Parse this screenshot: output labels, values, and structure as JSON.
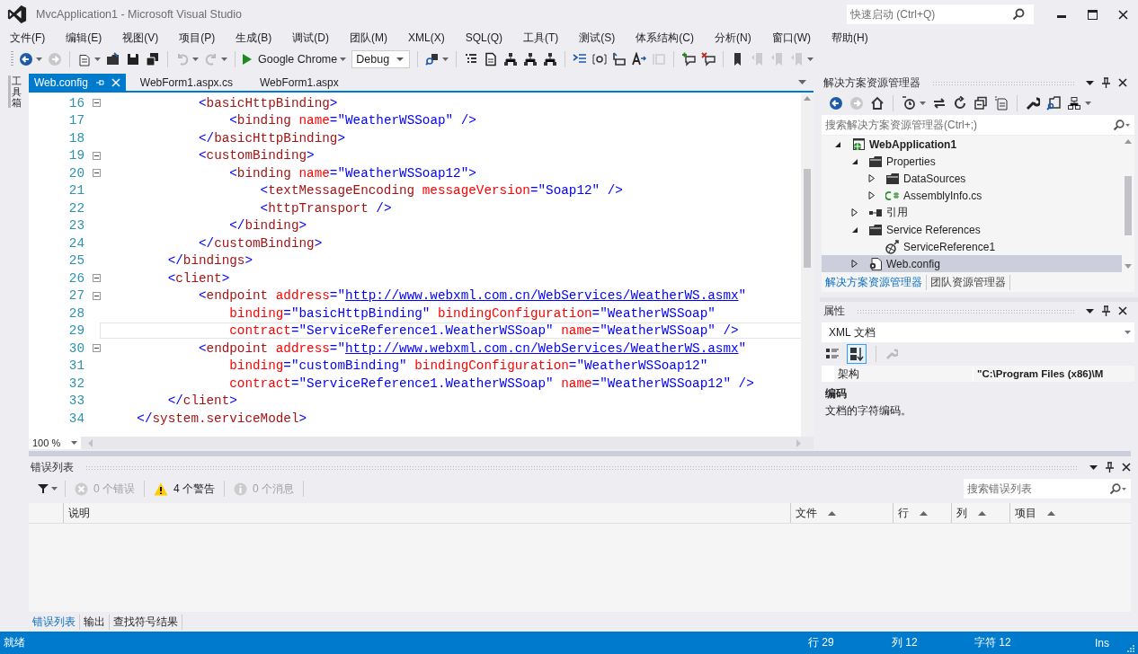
{
  "window": {
    "title": "MvcApplication1 - Microsoft Visual Studio",
    "quick_launch": {
      "placeholder": "快速启动 (Ctrl+Q)"
    }
  },
  "menu": [
    "文件(F)",
    "编辑(E)",
    "视图(V)",
    "项目(P)",
    "生成(B)",
    "调试(D)",
    "团队(M)",
    "XML(X)",
    "SQL(Q)",
    "工具(T)",
    "测试(S)",
    "体系结构(C)",
    "分析(N)",
    "窗口(W)",
    "帮助(H)"
  ],
  "toolbar": {
    "run_target": "Google Chrome",
    "configuration": "Debug"
  },
  "side_tab": "工具箱",
  "tabs": [
    {
      "label": "Web.config",
      "selected": true
    },
    {
      "label": "WebForm1.aspx.cs",
      "selected": false
    },
    {
      "label": "WebForm1.aspx",
      "selected": false
    }
  ],
  "editor": {
    "zoom": "100 %",
    "lines": [
      {
        "number": "16",
        "fold": true,
        "current": false,
        "tokens": [
          {
            "kind": "delim",
            "text": "            <"
          },
          {
            "kind": "tag",
            "text": "basicHttpBinding"
          },
          {
            "kind": "delim",
            "text": ">"
          }
        ]
      },
      {
        "number": "17",
        "fold": false,
        "current": false,
        "tokens": [
          {
            "kind": "delim",
            "text": "                <"
          },
          {
            "kind": "tag",
            "text": "binding"
          },
          {
            "kind": "attr",
            "text": " name"
          },
          {
            "kind": "delim",
            "text": "="
          },
          {
            "kind": "value",
            "text": "\"WeatherWSSoap\""
          },
          {
            "kind": "delim",
            "text": " />"
          }
        ]
      },
      {
        "number": "18",
        "fold": false,
        "current": false,
        "tokens": [
          {
            "kind": "delim",
            "text": "            </"
          },
          {
            "kind": "tag",
            "text": "basicHttpBinding"
          },
          {
            "kind": "delim",
            "text": ">"
          }
        ]
      },
      {
        "number": "19",
        "fold": true,
        "current": false,
        "tokens": [
          {
            "kind": "delim",
            "text": "            <"
          },
          {
            "kind": "tag",
            "text": "customBinding"
          },
          {
            "kind": "delim",
            "text": ">"
          }
        ]
      },
      {
        "number": "20",
        "fold": true,
        "current": false,
        "tokens": [
          {
            "kind": "delim",
            "text": "                <"
          },
          {
            "kind": "tag",
            "text": "binding"
          },
          {
            "kind": "attr",
            "text": " name"
          },
          {
            "kind": "delim",
            "text": "="
          },
          {
            "kind": "value",
            "text": "\"WeatherWSSoap12\""
          },
          {
            "kind": "delim",
            "text": ">"
          }
        ]
      },
      {
        "number": "21",
        "fold": false,
        "current": false,
        "tokens": [
          {
            "kind": "delim",
            "text": "                    <"
          },
          {
            "kind": "tag",
            "text": "textMessageEncoding"
          },
          {
            "kind": "attr",
            "text": " messageVersion"
          },
          {
            "kind": "delim",
            "text": "="
          },
          {
            "kind": "value",
            "text": "\"Soap12\""
          },
          {
            "kind": "delim",
            "text": " />"
          }
        ]
      },
      {
        "number": "22",
        "fold": false,
        "current": false,
        "tokens": [
          {
            "kind": "delim",
            "text": "                    <"
          },
          {
            "kind": "tag",
            "text": "httpTransport"
          },
          {
            "kind": "delim",
            "text": " />"
          }
        ]
      },
      {
        "number": "23",
        "fold": false,
        "current": false,
        "tokens": [
          {
            "kind": "delim",
            "text": "                </"
          },
          {
            "kind": "tag",
            "text": "binding"
          },
          {
            "kind": "delim",
            "text": ">"
          }
        ]
      },
      {
        "number": "24",
        "fold": false,
        "current": false,
        "tokens": [
          {
            "kind": "delim",
            "text": "            </"
          },
          {
            "kind": "tag",
            "text": "customBinding"
          },
          {
            "kind": "delim",
            "text": ">"
          }
        ]
      },
      {
        "number": "25",
        "fold": false,
        "current": false,
        "tokens": [
          {
            "kind": "delim",
            "text": "        </"
          },
          {
            "kind": "tag",
            "text": "bindings"
          },
          {
            "kind": "delim",
            "text": ">"
          }
        ]
      },
      {
        "number": "26",
        "fold": true,
        "current": false,
        "tokens": [
          {
            "kind": "delim",
            "text": "        <"
          },
          {
            "kind": "tag",
            "text": "client"
          },
          {
            "kind": "delim",
            "text": ">"
          }
        ]
      },
      {
        "number": "27",
        "fold": true,
        "current": false,
        "tokens": [
          {
            "kind": "delim",
            "text": "            <"
          },
          {
            "kind": "tag",
            "text": "endpoint"
          },
          {
            "kind": "attr",
            "text": " address"
          },
          {
            "kind": "delim",
            "text": "=\""
          },
          {
            "kind": "link",
            "text": "http://www.webxml.com.cn/WebServices/WeatherWS.asmx"
          },
          {
            "kind": "delim",
            "text": "\""
          }
        ]
      },
      {
        "number": "28",
        "fold": false,
        "current": false,
        "tokens": [
          {
            "kind": "attr",
            "text": "                binding"
          },
          {
            "kind": "delim",
            "text": "="
          },
          {
            "kind": "value",
            "text": "\"basicHttpBinding\""
          },
          {
            "kind": "attr",
            "text": " bindingConfiguration"
          },
          {
            "kind": "delim",
            "text": "="
          },
          {
            "kind": "value",
            "text": "\"WeatherWSSoap\""
          }
        ]
      },
      {
        "number": "29",
        "fold": false,
        "current": true,
        "tokens": [
          {
            "kind": "attr",
            "text": "                contract"
          },
          {
            "kind": "delim",
            "text": "="
          },
          {
            "kind": "value",
            "text": "\"ServiceReference1.WeatherWSSoap\""
          },
          {
            "kind": "attr",
            "text": " name"
          },
          {
            "kind": "delim",
            "text": "="
          },
          {
            "kind": "value",
            "text": "\"WeatherWSSoap\""
          },
          {
            "kind": "delim",
            "text": " />"
          }
        ]
      },
      {
        "number": "30",
        "fold": true,
        "current": false,
        "tokens": [
          {
            "kind": "delim",
            "text": "            <"
          },
          {
            "kind": "tag",
            "text": "endpoint"
          },
          {
            "kind": "attr",
            "text": " address"
          },
          {
            "kind": "delim",
            "text": "=\""
          },
          {
            "kind": "link",
            "text": "http://www.webxml.com.cn/WebServices/WeatherWS.asmx"
          },
          {
            "kind": "delim",
            "text": "\""
          }
        ]
      },
      {
        "number": "31",
        "fold": false,
        "current": false,
        "tokens": [
          {
            "kind": "attr",
            "text": "                binding"
          },
          {
            "kind": "delim",
            "text": "="
          },
          {
            "kind": "value",
            "text": "\"customBinding\""
          },
          {
            "kind": "attr",
            "text": " bindingConfiguration"
          },
          {
            "kind": "delim",
            "text": "="
          },
          {
            "kind": "value",
            "text": "\"WeatherWSSoap12\""
          }
        ]
      },
      {
        "number": "32",
        "fold": false,
        "current": false,
        "tokens": [
          {
            "kind": "attr",
            "text": "                contract"
          },
          {
            "kind": "delim",
            "text": "="
          },
          {
            "kind": "value",
            "text": "\"ServiceReference1.WeatherWSSoap\""
          },
          {
            "kind": "attr",
            "text": " name"
          },
          {
            "kind": "delim",
            "text": "="
          },
          {
            "kind": "value",
            "text": "\"WeatherWSSoap12\""
          },
          {
            "kind": "delim",
            "text": " />"
          }
        ]
      },
      {
        "number": "33",
        "fold": false,
        "current": false,
        "tokens": [
          {
            "kind": "delim",
            "text": "        </"
          },
          {
            "kind": "tag",
            "text": "client"
          },
          {
            "kind": "delim",
            "text": ">"
          }
        ]
      },
      {
        "number": "34",
        "fold": false,
        "current": false,
        "tokens": [
          {
            "kind": "delim",
            "text": "    </"
          },
          {
            "kind": "tag",
            "text": "system.serviceModel"
          },
          {
            "kind": "delim",
            "text": ">"
          }
        ]
      }
    ]
  },
  "solution_explorer": {
    "title": "解决方案资源管理器",
    "search": {
      "placeholder": "搜索解决方案资源管理器(Ctrl+;)"
    },
    "tree": [
      {
        "label": "WebApplication1",
        "kind": "project",
        "expanded": true,
        "selected": false,
        "children": [
          {
            "label": "Properties",
            "kind": "folder",
            "expanded": true,
            "selected": false,
            "children": [
              {
                "label": "DataSources",
                "kind": "folder",
                "expanded": false,
                "selected": false
              },
              {
                "label": "AssemblyInfo.cs",
                "kind": "csharp",
                "expanded": false,
                "selected": false
              }
            ]
          },
          {
            "label": "引用",
            "kind": "references",
            "expanded": false,
            "selected": false
          },
          {
            "label": "Service References",
            "kind": "folder",
            "expanded": true,
            "selected": false,
            "children": [
              {
                "label": "ServiceReference1",
                "kind": "service",
                "selected": false
              }
            ]
          },
          {
            "label": "Web.config",
            "kind": "config",
            "expanded": false,
            "selected": true
          }
        ]
      }
    ],
    "tabs": [
      {
        "label": "解决方案资源管理器",
        "selected": true
      },
      {
        "label": "团队资源管理器",
        "selected": false
      }
    ]
  },
  "properties": {
    "title": "属性",
    "object": "XML 文档",
    "rows": [
      {
        "name": "架构",
        "value": "\"C:\\Program Files (x86)\\M"
      }
    ],
    "description_title": "编码",
    "description": "文档的字符编码。"
  },
  "error_list": {
    "title": "错误列表",
    "filters": [
      {
        "kind": "error",
        "label": "0 个错误",
        "enabled": false
      },
      {
        "kind": "warning",
        "label": "4 个警告",
        "enabled": true
      },
      {
        "kind": "info",
        "label": "0 个消息",
        "enabled": false
      }
    ],
    "search": {
      "placeholder": "搜索错误列表"
    },
    "columns": [
      "说明",
      "文件",
      "行",
      "列",
      "项目"
    ]
  },
  "bottom_tabs": [
    {
      "label": "错误列表",
      "selected": true
    },
    {
      "label": "输出",
      "selected": false
    },
    {
      "label": "查找符号结果",
      "selected": false
    }
  ],
  "status_bar": {
    "message": "就绪",
    "line": "行 29",
    "column": "列 12",
    "char": "字符 12",
    "mode": "Ins"
  }
}
